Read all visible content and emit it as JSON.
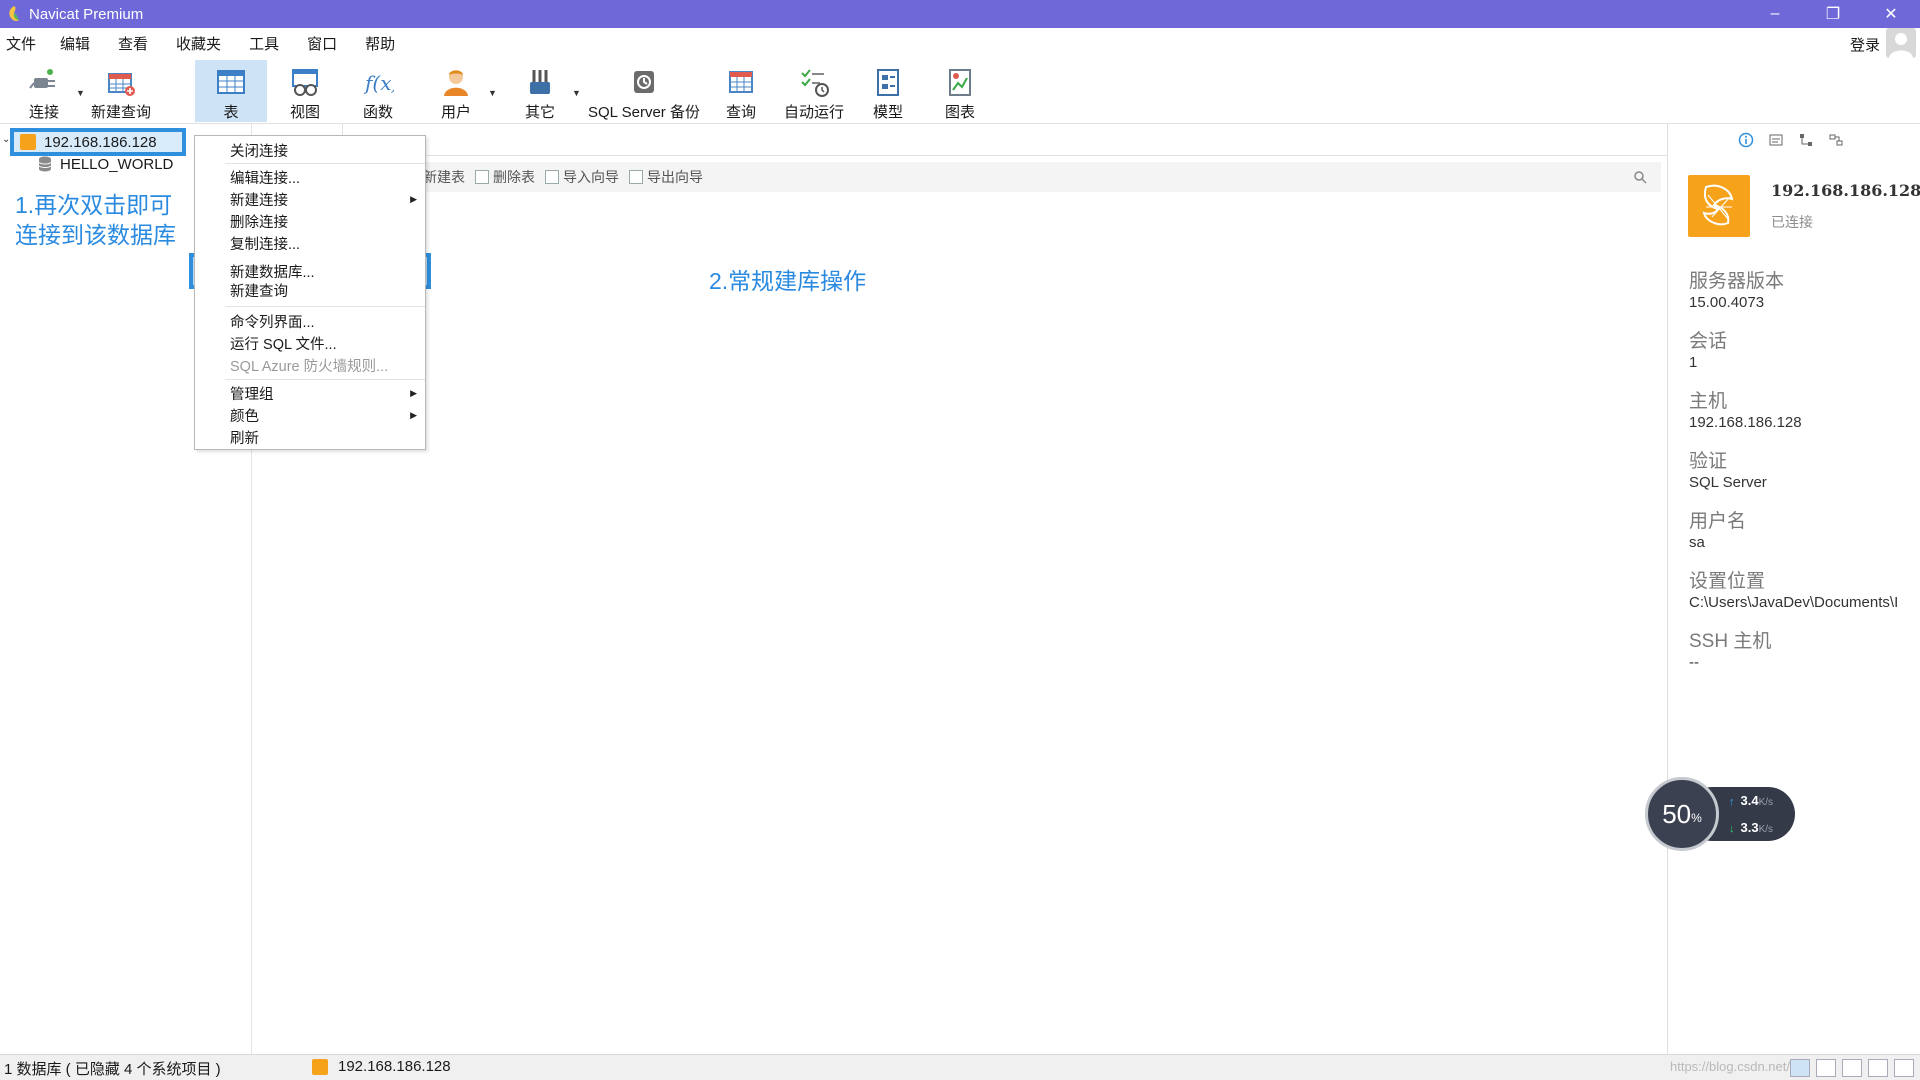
{
  "window": {
    "title": "Navicat Premium"
  },
  "menu": [
    "文件",
    "编辑",
    "查看",
    "收藏夹",
    "工具",
    "窗口",
    "帮助"
  ],
  "account": {
    "login": "登录"
  },
  "toolbar": {
    "connect": "连接",
    "new_query": "新建查询",
    "table": "表",
    "view": "视图",
    "function": "函数",
    "user": "用户",
    "other": "其它",
    "backup": "SQL Server 备份",
    "query": "查询",
    "automation": "自动运行",
    "model": "模型",
    "chart": "图表"
  },
  "tree": {
    "connection": "192.168.186.128",
    "database": "HELLO_WORLD"
  },
  "annotations": {
    "step1_line1": "1.再次双击即可",
    "step1_line2": "连接到该数据库",
    "step2": "2.常规建库操作"
  },
  "object_toolbar": {
    "new_table": "新建表",
    "delete_table": "删除表",
    "import": "导入向导",
    "export": "导出向导"
  },
  "context_menu": {
    "close_conn": "关闭连接",
    "edit_conn": "编辑连接...",
    "new_conn": "新建连接",
    "delete_conn": "删除连接",
    "copy_conn": "复制连接...",
    "new_db": "新建数据库...",
    "new_query": "新建查询",
    "console": "命令列界面...",
    "run_sql": "运行 SQL 文件...",
    "azure": "SQL Azure 防火墙规则...",
    "group": "管理组",
    "color": "颜色",
    "refresh": "刷新"
  },
  "info_panel": {
    "name": "192.168.186.128",
    "status": "已连接",
    "server_version_label": "服务器版本",
    "server_version": "15.00.4073",
    "session_label": "会话",
    "session": "1",
    "host_label": "主机",
    "host": "192.168.186.128",
    "auth_label": "验证",
    "auth": "SQL Server",
    "user_label": "用户名",
    "user": "sa",
    "location_label": "设置位置",
    "location": "C:\\Users\\JavaDev\\Documents\\I",
    "ssh_label": "SSH 主机",
    "ssh": "--"
  },
  "network": {
    "percent": "50",
    "percent_sign": "%",
    "up": "3.4",
    "down": "3.3",
    "unit": "K/s"
  },
  "status": {
    "left": "1 数据库 ( 已隐藏 4 个系统项目 )",
    "connection": "192.168.186.128",
    "watermark": "https://blog.csdn.net/..."
  },
  "colors": {
    "titlebar": "#6f68d9",
    "accent_blue": "#2f8fdc",
    "annotation": "#2a8ae0",
    "sqlserver_orange": "#f7a21b"
  }
}
